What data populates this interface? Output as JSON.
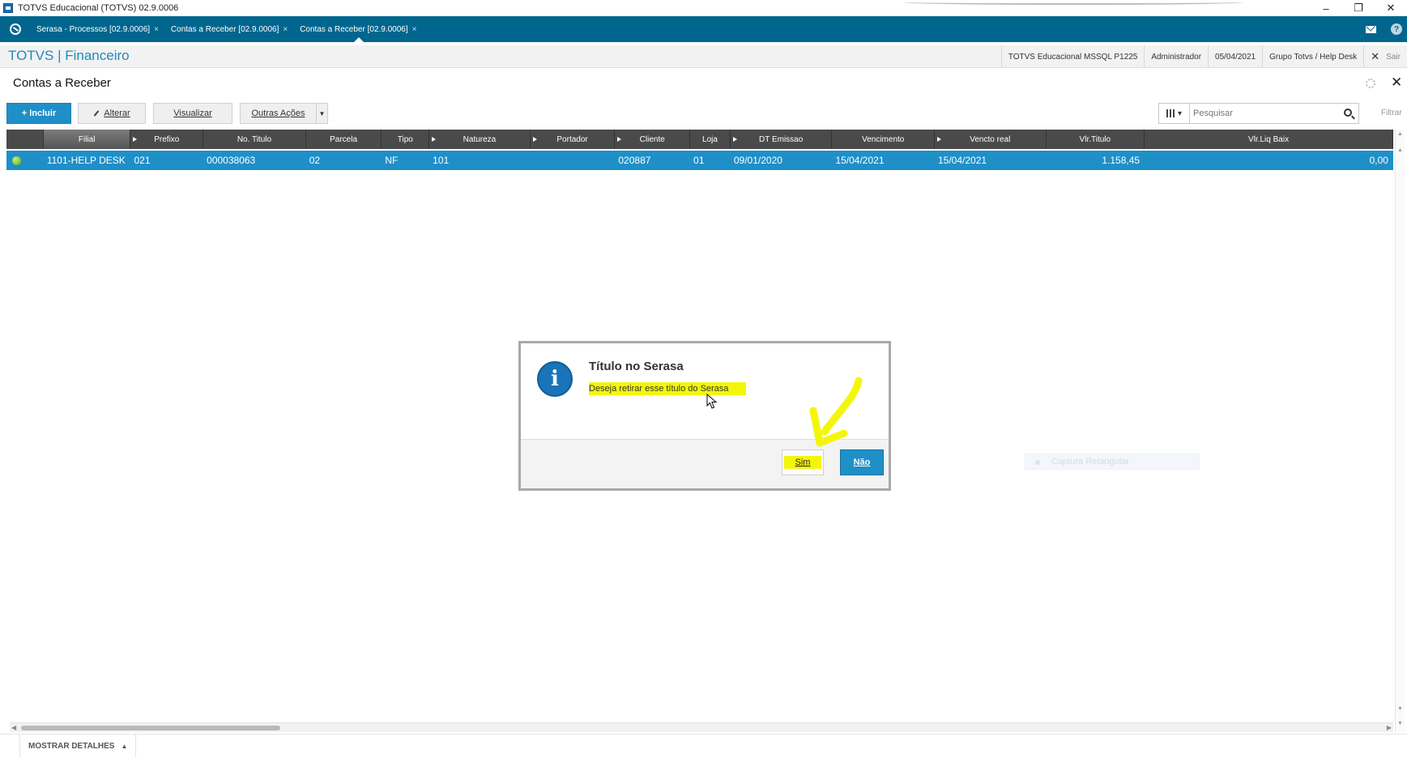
{
  "window": {
    "title": "TOTVS Educacional (TOTVS) 02.9.0006",
    "minimize": "–",
    "restore": "❐",
    "close": "✕"
  },
  "tabs": [
    {
      "label": "Serasa - Processos [02.9.0006]",
      "close": "×"
    },
    {
      "label": "Contas a Receber [02.9.0006]",
      "close": "×"
    },
    {
      "label": "Contas a Receber [02.9.0006]",
      "close": "×"
    }
  ],
  "header": {
    "brand": "TOTVS | Financeiro",
    "environment": "TOTVS Educacional MSSQL P1225",
    "user": "Administrador",
    "date": "05/04/2021",
    "group": "Grupo Totvs / Help Desk",
    "exit_x": "✕",
    "exit_label": "Sair"
  },
  "page": {
    "title": "Contas a Receber",
    "close": "✕"
  },
  "toolbar": {
    "incluir": "+ Incluir",
    "alterar": "Alterar",
    "visualizar": "Visualizar",
    "outras": "Outras Ações",
    "outras_arrow": "▼",
    "search_placeholder": "Pesquisar",
    "columns_arrow": "▾",
    "filtrar": "Filtrar"
  },
  "grid": {
    "columns": [
      "Filial",
      "Prefixo",
      "No. Titulo",
      "Parcela",
      "Tipo",
      "Natureza",
      "Portador",
      "Cliente",
      "Loja",
      "DT Emissao",
      "Vencimento",
      "Vencto real",
      "Vlr.Titulo",
      "Vlr.Liq Baix"
    ],
    "rows": [
      {
        "filial": "1101-HELP DESK",
        "prefixo": "021",
        "no_titulo": "000038063",
        "parcela": "02",
        "tipo": "NF",
        "natureza": "101",
        "portador": "",
        "cliente": "020887",
        "loja": "01",
        "dt_emissao": "09/01/2020",
        "vencimento": "15/04/2021",
        "vencto_real": "15/04/2021",
        "vlr_titulo": "1.158,45",
        "vlr_liq_baix": "0,00"
      }
    ]
  },
  "dialog": {
    "icon": "i",
    "title": "Título no Serasa",
    "message": "Deseja retirar esse título do Serasa",
    "yes": "Sim",
    "no": "Não"
  },
  "footer": {
    "details": "MOSTRAR DETALHES",
    "details_arrow": "▲"
  },
  "overlay": {
    "captura": "Captura Retangular"
  },
  "colors": {
    "tabbar": "#00668e",
    "primary": "#1f8fc8",
    "highlight": "#f4f60a",
    "header_grid": "#4a4a4a"
  }
}
